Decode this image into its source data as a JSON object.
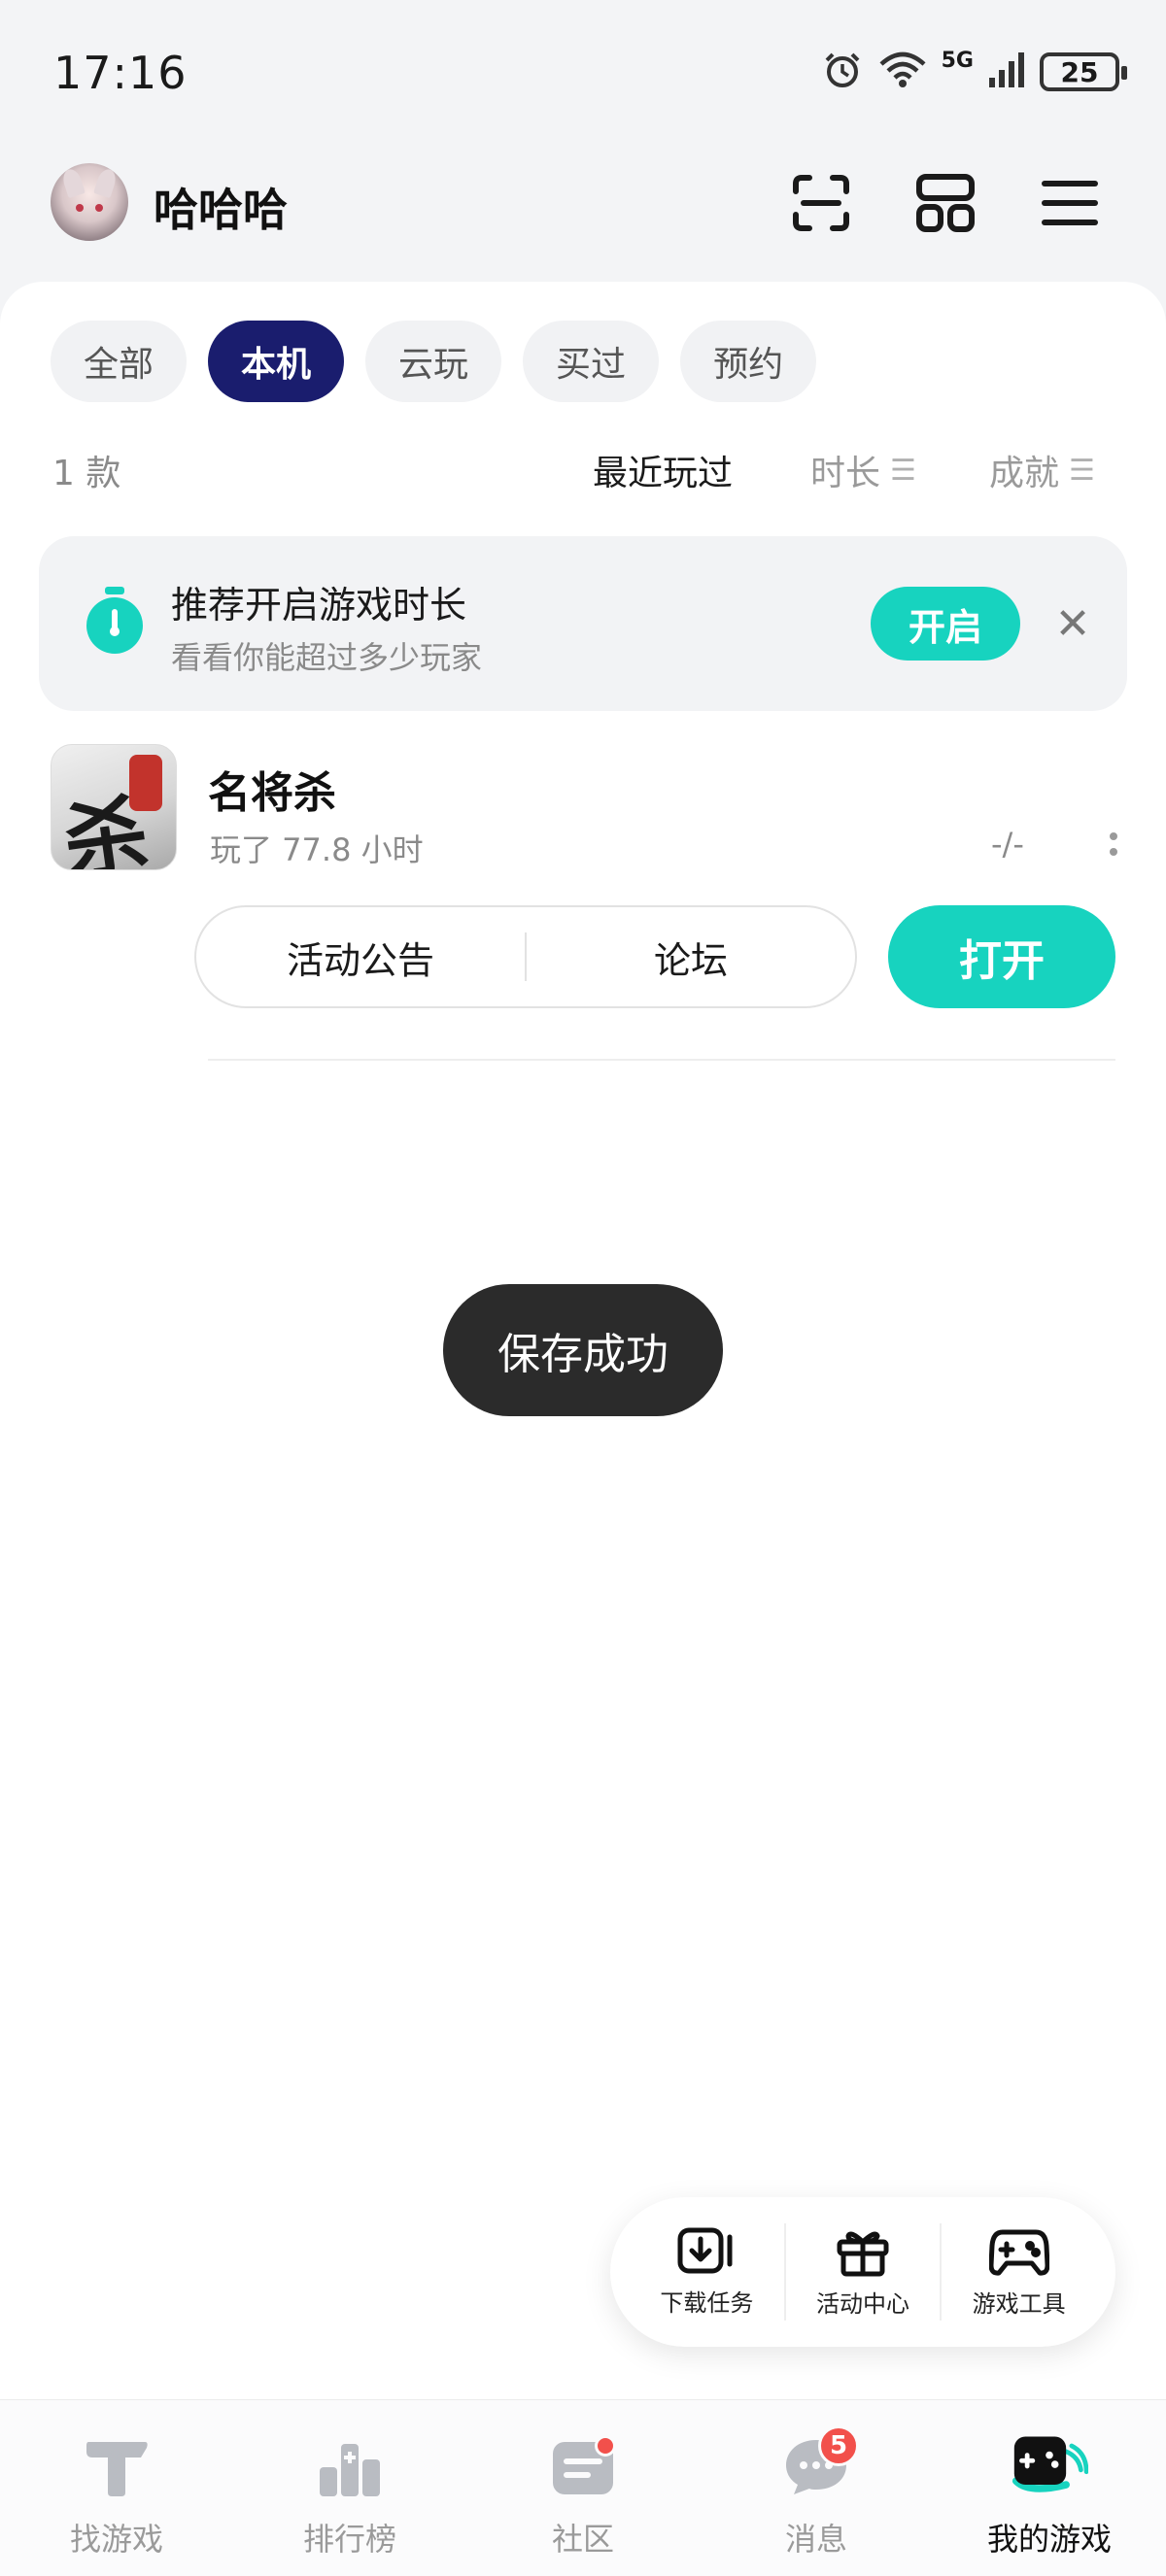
{
  "status_bar": {
    "time": "17:16",
    "network": "5G",
    "battery": "25"
  },
  "header": {
    "username": "哈哈哈"
  },
  "filter_tabs": [
    "全部",
    "本机",
    "云玩",
    "买过",
    "预约"
  ],
  "active_tab": "本机",
  "list_meta": {
    "count": "1 款",
    "sort_options": [
      "最近玩过",
      "时长",
      "成就"
    ],
    "active_sort": "最近玩过"
  },
  "recommend_banner": {
    "title": "推荐开启游戏时长",
    "subtitle": "看看你能超过多少玩家",
    "enable_label": "开启",
    "close_glyph": "✕"
  },
  "games": [
    {
      "name": "名将杀",
      "played": "玩了 77.8 小时",
      "rank": "-/-",
      "actions": [
        "活动公告",
        "论坛"
      ],
      "open_label": "打开"
    }
  ],
  "toast": {
    "text": "保存成功"
  },
  "float_tools": [
    "下载任务",
    "活动中心",
    "游戏工具"
  ],
  "bottom_nav": {
    "items": [
      "找游戏",
      "排行榜",
      "社区",
      "消息",
      "我的游戏"
    ],
    "active": "我的游戏",
    "message_badge": "5"
  },
  "colors": {
    "accent": "#17d3bf",
    "active_tab": "#1a1d6e",
    "badge": "#f2504b"
  }
}
